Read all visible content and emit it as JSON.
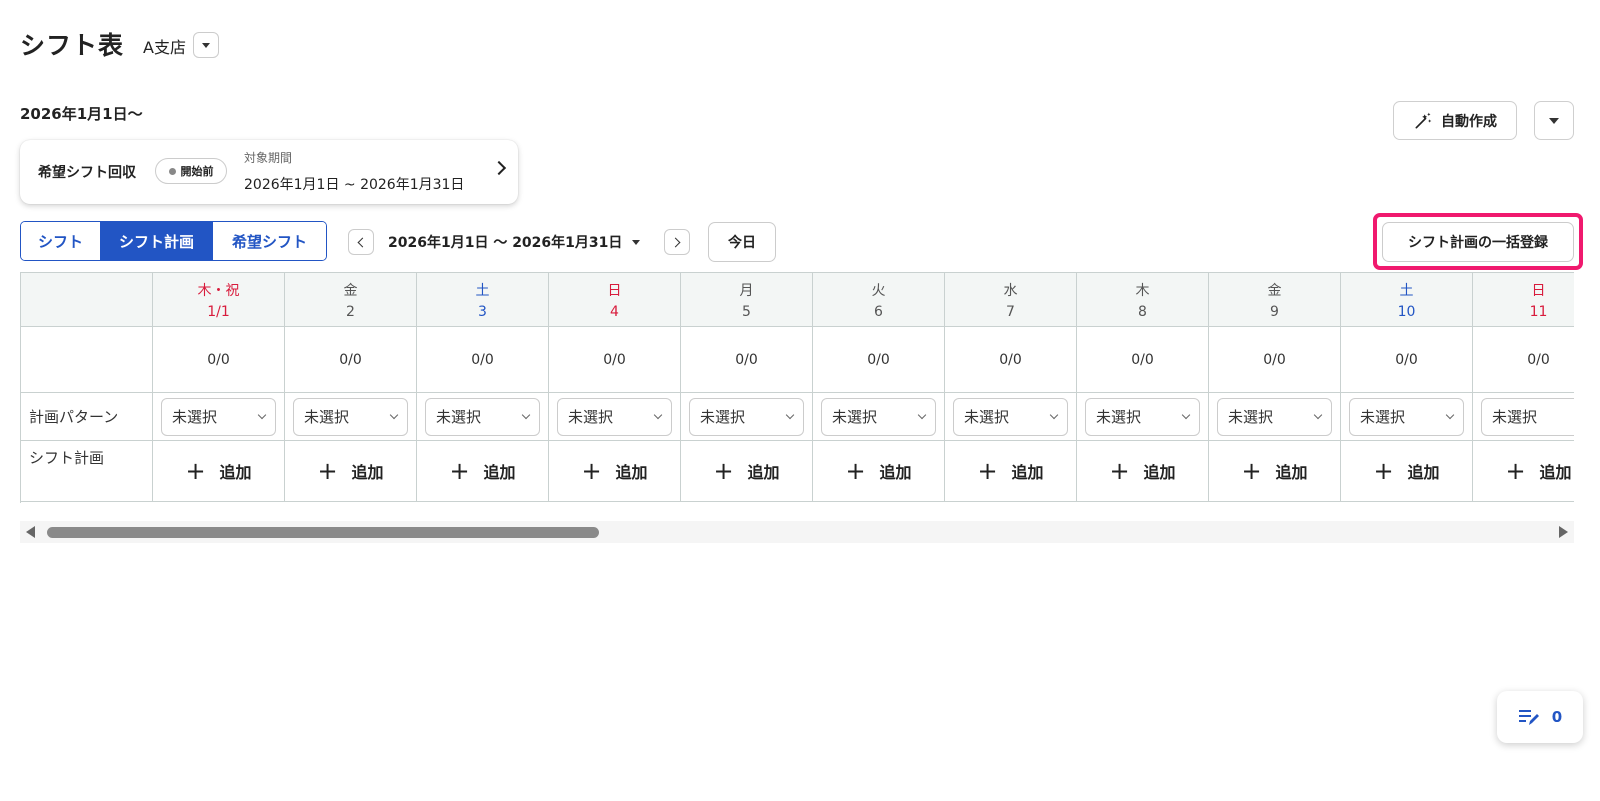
{
  "header": {
    "title": "シフト表",
    "branch": "A支店"
  },
  "period_heading": "2026年1月1日〜",
  "auto_create": {
    "label": "自動作成"
  },
  "request_card": {
    "title": "希望シフト回収",
    "status": "開始前",
    "period_label": "対象期間",
    "period": "2026年1月1日 ~ 2026年1月31日"
  },
  "tabs": [
    {
      "label": "シフト",
      "active": false
    },
    {
      "label": "シフト計画",
      "active": true
    },
    {
      "label": "希望シフト",
      "active": false
    }
  ],
  "date_range": "2026年1月1日 〜 2026年1月31日",
  "today_label": "今日",
  "bulk_register_label": "シフト計画の一括登録",
  "grid": {
    "row_labels": {
      "pattern": "計画パターン",
      "plan": "シフト計画"
    },
    "days": [
      {
        "weekday": "木・祝",
        "date": "1/1",
        "type": "holiday",
        "count": "0/0",
        "pattern": "未選択",
        "add": "追加"
      },
      {
        "weekday": "金",
        "date": "2",
        "type": "weekday",
        "count": "0/0",
        "pattern": "未選択",
        "add": "追加"
      },
      {
        "weekday": "土",
        "date": "3",
        "type": "saturday",
        "count": "0/0",
        "pattern": "未選択",
        "add": "追加"
      },
      {
        "weekday": "日",
        "date": "4",
        "type": "sunday",
        "count": "0/0",
        "pattern": "未選択",
        "add": "追加"
      },
      {
        "weekday": "月",
        "date": "5",
        "type": "weekday",
        "count": "0/0",
        "pattern": "未選択",
        "add": "追加"
      },
      {
        "weekday": "火",
        "date": "6",
        "type": "weekday",
        "count": "0/0",
        "pattern": "未選択",
        "add": "追加"
      },
      {
        "weekday": "水",
        "date": "7",
        "type": "weekday",
        "count": "0/0",
        "pattern": "未選択",
        "add": "追加"
      },
      {
        "weekday": "木",
        "date": "8",
        "type": "weekday",
        "count": "0/0",
        "pattern": "未選択",
        "add": "追加"
      },
      {
        "weekday": "金",
        "date": "9",
        "type": "weekday",
        "count": "0/0",
        "pattern": "未選択",
        "add": "追加"
      },
      {
        "weekday": "土",
        "date": "10",
        "type": "saturday",
        "count": "0/0",
        "pattern": "未選択",
        "add": "追加"
      },
      {
        "weekday": "日",
        "date": "11",
        "type": "sunday",
        "count": "0/0",
        "pattern": "未選択",
        "add": "追加"
      }
    ]
  },
  "icons": {
    "branch_dropdown": "caret-down-icon",
    "auto_create": "magic-wand-icon",
    "request_arrow": "chevron-right-icon",
    "prev": "chevron-left-icon",
    "next": "chevron-right-icon",
    "notes": "edit-list-icon"
  },
  "colors": {
    "accent": "#2255c4",
    "holiday": "#d81b3c",
    "saturday": "#2255c4",
    "highlight": "#f0196e"
  },
  "notes_count": "0"
}
